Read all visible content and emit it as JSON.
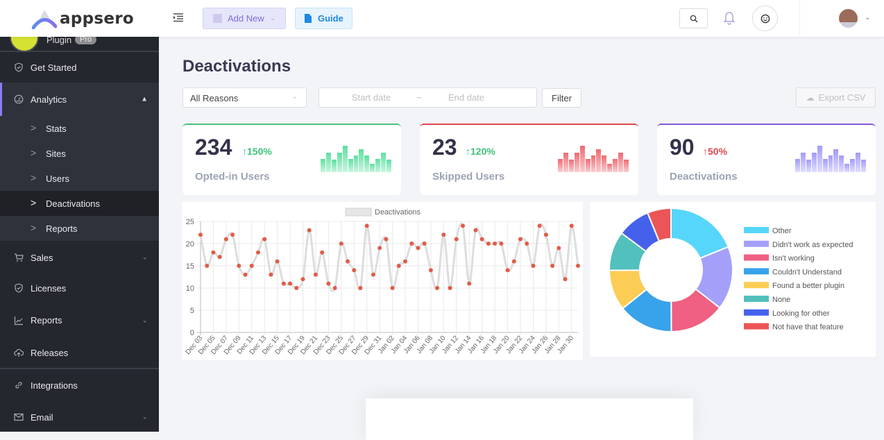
{
  "brand": {
    "name": "appsero"
  },
  "topbar": {
    "add_new_label": "Add New",
    "guide_label": "Guide",
    "icons": [
      "menu-toggle-icon",
      "search-icon",
      "bell-icon",
      "smile-icon",
      "avatar"
    ]
  },
  "sidebar": {
    "plugin_name": "Plugin",
    "plugin_badge": "Pro",
    "items": [
      {
        "label": "Get Started",
        "icon": "shield-check-icon"
      },
      {
        "label": "Analytics",
        "icon": "dashboard-icon",
        "expanded": true,
        "children": [
          {
            "label": "Stats"
          },
          {
            "label": "Sites"
          },
          {
            "label": "Users"
          },
          {
            "label": "Deactivations",
            "active": true
          },
          {
            "label": "Reports"
          }
        ]
      },
      {
        "label": "Sales",
        "icon": "cart-icon"
      },
      {
        "label": "Licenses",
        "icon": "shield-icon"
      },
      {
        "label": "Reports",
        "icon": "line-chart-icon"
      },
      {
        "label": "Releases",
        "icon": "cloud-upload-icon"
      },
      {
        "label": "Integrations",
        "icon": "link-icon"
      },
      {
        "label": "Email",
        "icon": "envelope-icon"
      }
    ]
  },
  "page": {
    "title": "Deactivations",
    "reason_select": "All Reasons",
    "start_placeholder": "Start date",
    "end_placeholder": "End date",
    "range_sep": "~",
    "filter_label": "Filter",
    "export_label": "Export CSV"
  },
  "cards": [
    {
      "value": "234",
      "change": "↑150%",
      "label": "Opted-in Users",
      "accent": "#4cc07a",
      "change_color": "#3ec27b",
      "bar_color": "#5ee0a0"
    },
    {
      "value": "23",
      "change": "↑120%",
      "label": "Skipped Users",
      "accent": "#e0484d",
      "change_color": "#3ec27b",
      "bar_color": "#ef6b73"
    },
    {
      "value": "90",
      "change": "↑50%",
      "label": "Deactivations",
      "accent": "#8058d8",
      "change_color": "#e0484d",
      "bar_color": "#a39bf7"
    }
  ],
  "mini_bars": [
    4,
    6,
    3.7,
    6,
    8,
    4,
    5,
    7,
    5,
    2.5,
    4,
    6,
    3.7
  ],
  "chart_data": [
    {
      "type": "line",
      "title": "",
      "legend": [
        "Deactivations"
      ],
      "legend_position": "top",
      "xlabel": "",
      "ylabel": "",
      "ylim": [
        0,
        25
      ],
      "yticks": [
        0,
        5,
        10,
        15,
        20,
        25
      ],
      "grid": true,
      "line_color": "#dddddd",
      "point_color": "#e05c45",
      "x": [
        "Dec 03",
        "Dec 04",
        "Dec 05",
        "Dec 06",
        "Dec 07",
        "Dec 08",
        "Dec 09",
        "Dec 10",
        "Dec 11",
        "Dec 12",
        "Dec 13",
        "Dec 14",
        "Dec 15",
        "Dec 16",
        "Dec 17",
        "Dec 18",
        "Dec 19",
        "Dec 20",
        "Dec 21",
        "Dec 22",
        "Dec 23",
        "Dec 24",
        "Dec 25",
        "Dec 26",
        "Dec 27",
        "Dec 28",
        "Dec 29",
        "Dec 30",
        "Dec 31",
        "Jan 01",
        "Jan 02",
        "Jan 03",
        "Jan 04",
        "Jan 05",
        "Jan 06",
        "Jan 07",
        "Jan 08",
        "Jan 09",
        "Jan 10",
        "Jan 11",
        "Jan 12",
        "Jan 13",
        "Jan 14",
        "Jan 15",
        "Jan 16",
        "Jan 17",
        "Jan 18",
        "Jan 19",
        "Jan 20",
        "Jan 21",
        "Jan 22",
        "Jan 23",
        "Jan 24",
        "Jan 25",
        "Jan 26",
        "Jan 27",
        "Jan 28",
        "Jan 29",
        "Jan 30",
        "Jan 31"
      ],
      "xtick_labels": [
        "Dec 03",
        "Dec 05",
        "Dec 07",
        "Dec 09",
        "Dec 11",
        "Dec 13",
        "Dec 15",
        "Dec 17",
        "Dec 19",
        "Dec 21",
        "Dec 23",
        "Dec 25",
        "Dec 27",
        "Dec 29",
        "Dec 31",
        "Jan 02",
        "Jan 04",
        "Jan 06",
        "Jan 08",
        "Jan 10",
        "Jan 12",
        "Jan 14",
        "Jan 16",
        "Jan 18",
        "Jan 20",
        "Jan 22",
        "Jan 24",
        "Jan 26",
        "Jan 28",
        "Jan 30"
      ],
      "series": [
        {
          "name": "Deactivations",
          "values": [
            22,
            15,
            18,
            17,
            21,
            22,
            15,
            13,
            15,
            18,
            21,
            13,
            16,
            11,
            11,
            10,
            12,
            23,
            13,
            18,
            11,
            10,
            20,
            16,
            14,
            10,
            24,
            13,
            19,
            21,
            10,
            15,
            16,
            20,
            19,
            20,
            14,
            10,
            22,
            10,
            21,
            24,
            11,
            23,
            21,
            20,
            20,
            20,
            14,
            16,
            21,
            20,
            15,
            24,
            22,
            15,
            19,
            12,
            24,
            15
          ]
        }
      ]
    },
    {
      "type": "pie",
      "subtype": "doughnut",
      "legend_position": "right",
      "categories": [
        "Other",
        "Didn't work as expected",
        "Isn't working",
        "Couldn't Understand",
        "Found a better plugin",
        "None",
        "Looking for other",
        "Not have that feature"
      ],
      "values": [
        18.9,
        16.6,
        14.4,
        14.4,
        10.6,
        10.3,
        8.6,
        6.2
      ],
      "colors": [
        "#56d6fb",
        "#a4a0fa",
        "#ef6083",
        "#38a2ea",
        "#fccd55",
        "#52c0bc",
        "#4561ec",
        "#eb5557"
      ]
    }
  ]
}
